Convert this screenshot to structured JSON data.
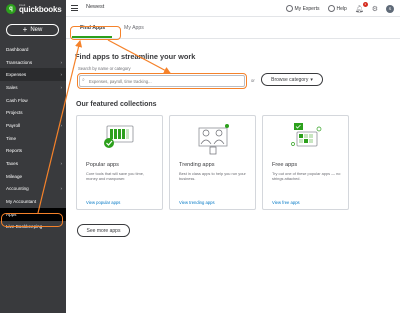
{
  "logo": {
    "small": "intuit",
    "text": "quickbooks",
    "mark": "q"
  },
  "sidebar": {
    "new_label": "New",
    "items": [
      {
        "label": "Dashboard",
        "chevron": false
      },
      {
        "label": "Transactions",
        "chevron": true
      },
      {
        "label": "Expenses",
        "chevron": true
      },
      {
        "label": "Sales",
        "chevron": true
      },
      {
        "label": "Cash Flow",
        "chevron": false
      },
      {
        "label": "Projects",
        "chevron": false
      },
      {
        "label": "Payroll",
        "chevron": true
      },
      {
        "label": "Time",
        "chevron": false
      },
      {
        "label": "Reports",
        "chevron": false
      },
      {
        "label": "Taxes",
        "chevron": true
      },
      {
        "label": "Mileage",
        "chevron": false
      },
      {
        "label": "Accounting",
        "chevron": true
      },
      {
        "label": "My Accountant",
        "chevron": false
      },
      {
        "label": "Apps",
        "chevron": false
      },
      {
        "label": "Live Bookkeeping",
        "chevron": false
      }
    ]
  },
  "topbar": {
    "company": "Newest",
    "my_experts": "My Experts",
    "help": "Help",
    "notification_count": "1",
    "avatar_initial": "S"
  },
  "tabs": [
    {
      "label": "Find Apps"
    },
    {
      "label": "My Apps"
    }
  ],
  "main": {
    "title": "Find apps to streamline your work",
    "search_label": "Search by name or category",
    "search_placeholder": "Expenses, payroll, time tracking...",
    "or_text": "or",
    "browse_label": "Browse category",
    "section_title": "Our featured collections",
    "see_more": "See more apps"
  },
  "cards": [
    {
      "title": "Popular apps",
      "desc": "Core tools that will save you time, money and manpower.",
      "link": "View popular apps"
    },
    {
      "title": "Trending apps",
      "desc": "Best in class apps to help you run your business.",
      "link": "View trending apps"
    },
    {
      "title": "Free apps",
      "desc": "Try out one of these popular apps — no strings attached.",
      "link": "View free apps"
    }
  ],
  "colors": {
    "sidebar_bg": "#393a3d",
    "accent_green": "#2ca01c",
    "link_blue": "#0077c5",
    "annotation_orange": "#f5822a"
  },
  "icons": [
    "hamburger-icon",
    "my-experts-icon",
    "help-icon",
    "bell-icon",
    "gear-icon",
    "search-icon",
    "chevron-down-icon",
    "plus-icon"
  ]
}
